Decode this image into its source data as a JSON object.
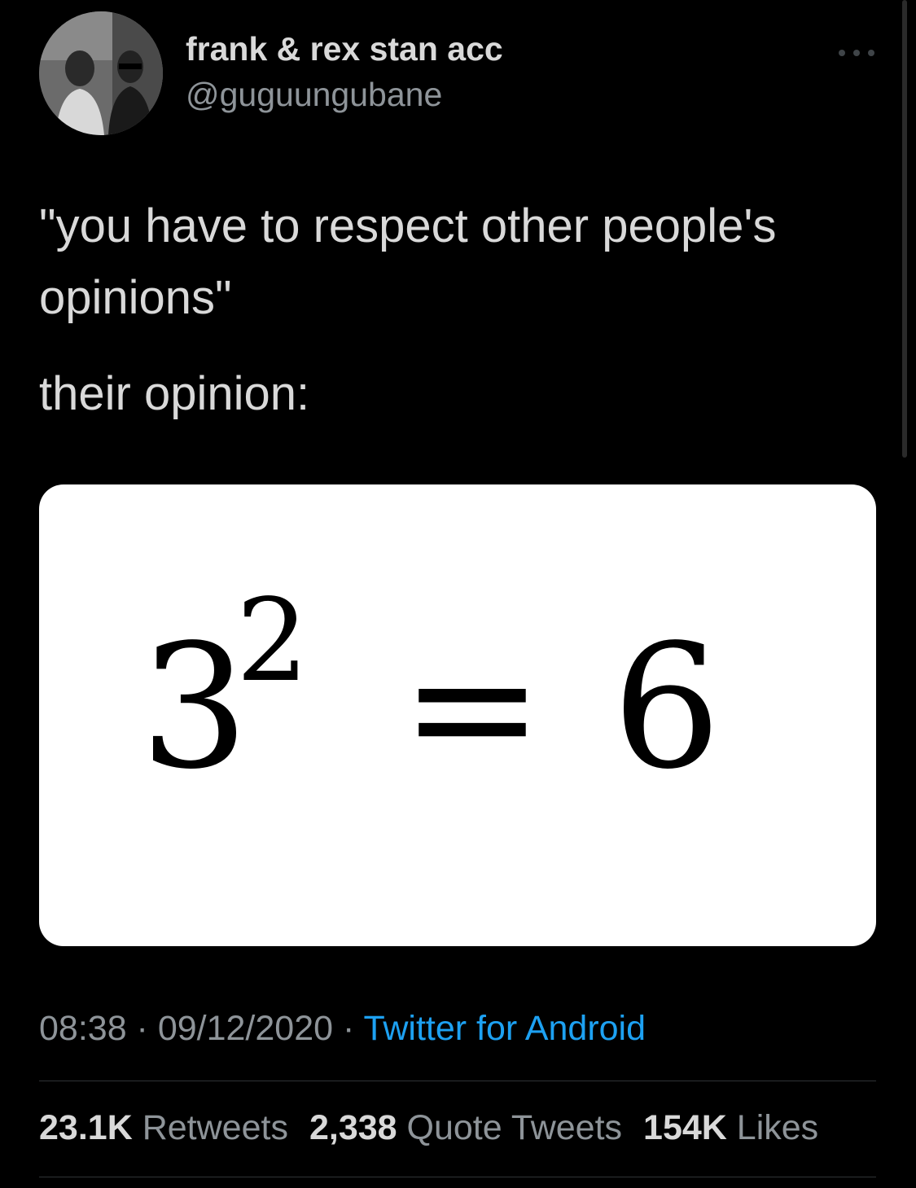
{
  "author": {
    "display_name": "frank & rex stan acc",
    "handle": "@guguungubane",
    "avatar_icon": "profile-photo"
  },
  "more_icon": "ellipsis-icon",
  "tweet": {
    "text_line1": "\"you have to respect other people's opinions\"",
    "text_line2": "their opinion:"
  },
  "media": {
    "equation_base": "3",
    "equation_exponent": "2",
    "equation_equals": "=",
    "equation_result": "6"
  },
  "meta": {
    "time": "08:38",
    "separator1": " · ",
    "date": "09/12/2020",
    "separator2": " · ",
    "source": "Twitter for Android"
  },
  "stats": {
    "retweets_count": "23.1K",
    "retweets_label": "Retweets",
    "quotes_count": "2,338",
    "quotes_label": "Quote Tweets",
    "likes_count": "154K",
    "likes_label": "Likes"
  },
  "colors": {
    "background": "#000000",
    "primary_text": "#d9d9d9",
    "secondary_text": "#8e9499",
    "link": "#1da1f2",
    "divider": "#2f3336"
  }
}
